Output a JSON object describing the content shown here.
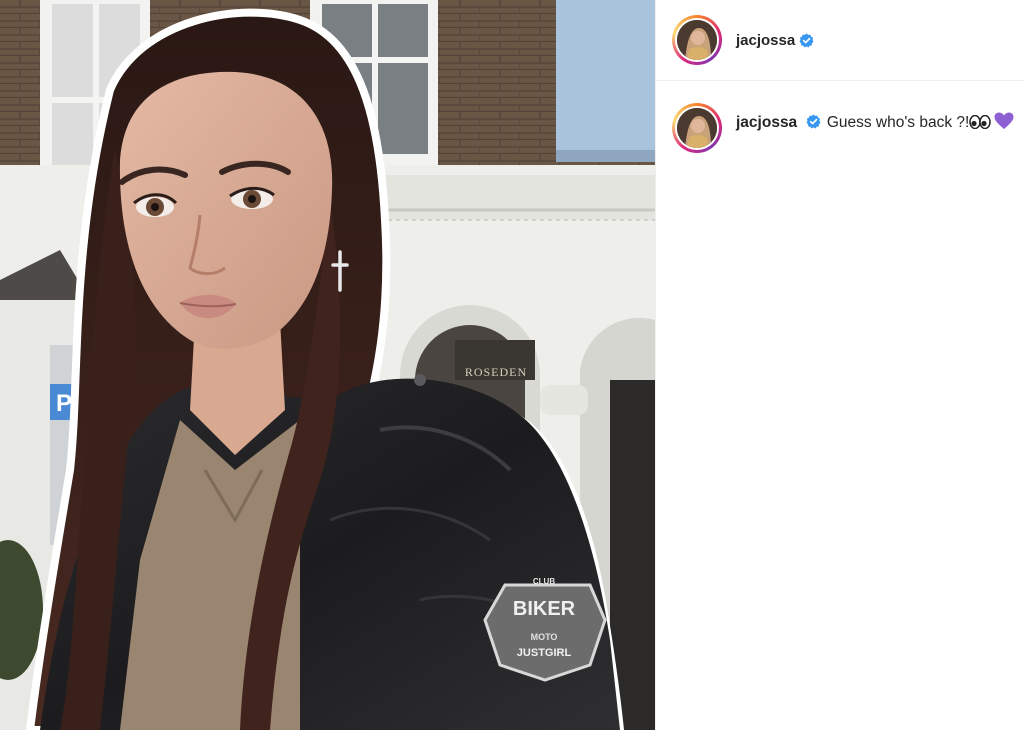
{
  "post": {
    "username": "jacjossa",
    "verified": true,
    "avatar_icon": "profile-photo",
    "caption": {
      "username": "jacjossa",
      "text": "Guess who's back ?!",
      "emojis": [
        "eyes-emoji",
        "purple-heart-emoji"
      ]
    }
  },
  "media": {
    "sign_text": "ROSEDEN",
    "parking_sign": "P",
    "patch_text": {
      "top": "CLUB",
      "main": "BIKER",
      "sub1": "MOTO",
      "sub2": "JUSTGIRL"
    }
  },
  "colors": {
    "verified_blue": "#3897f0",
    "heart_purple": "#8d5fd3",
    "text_dark": "#262626"
  }
}
